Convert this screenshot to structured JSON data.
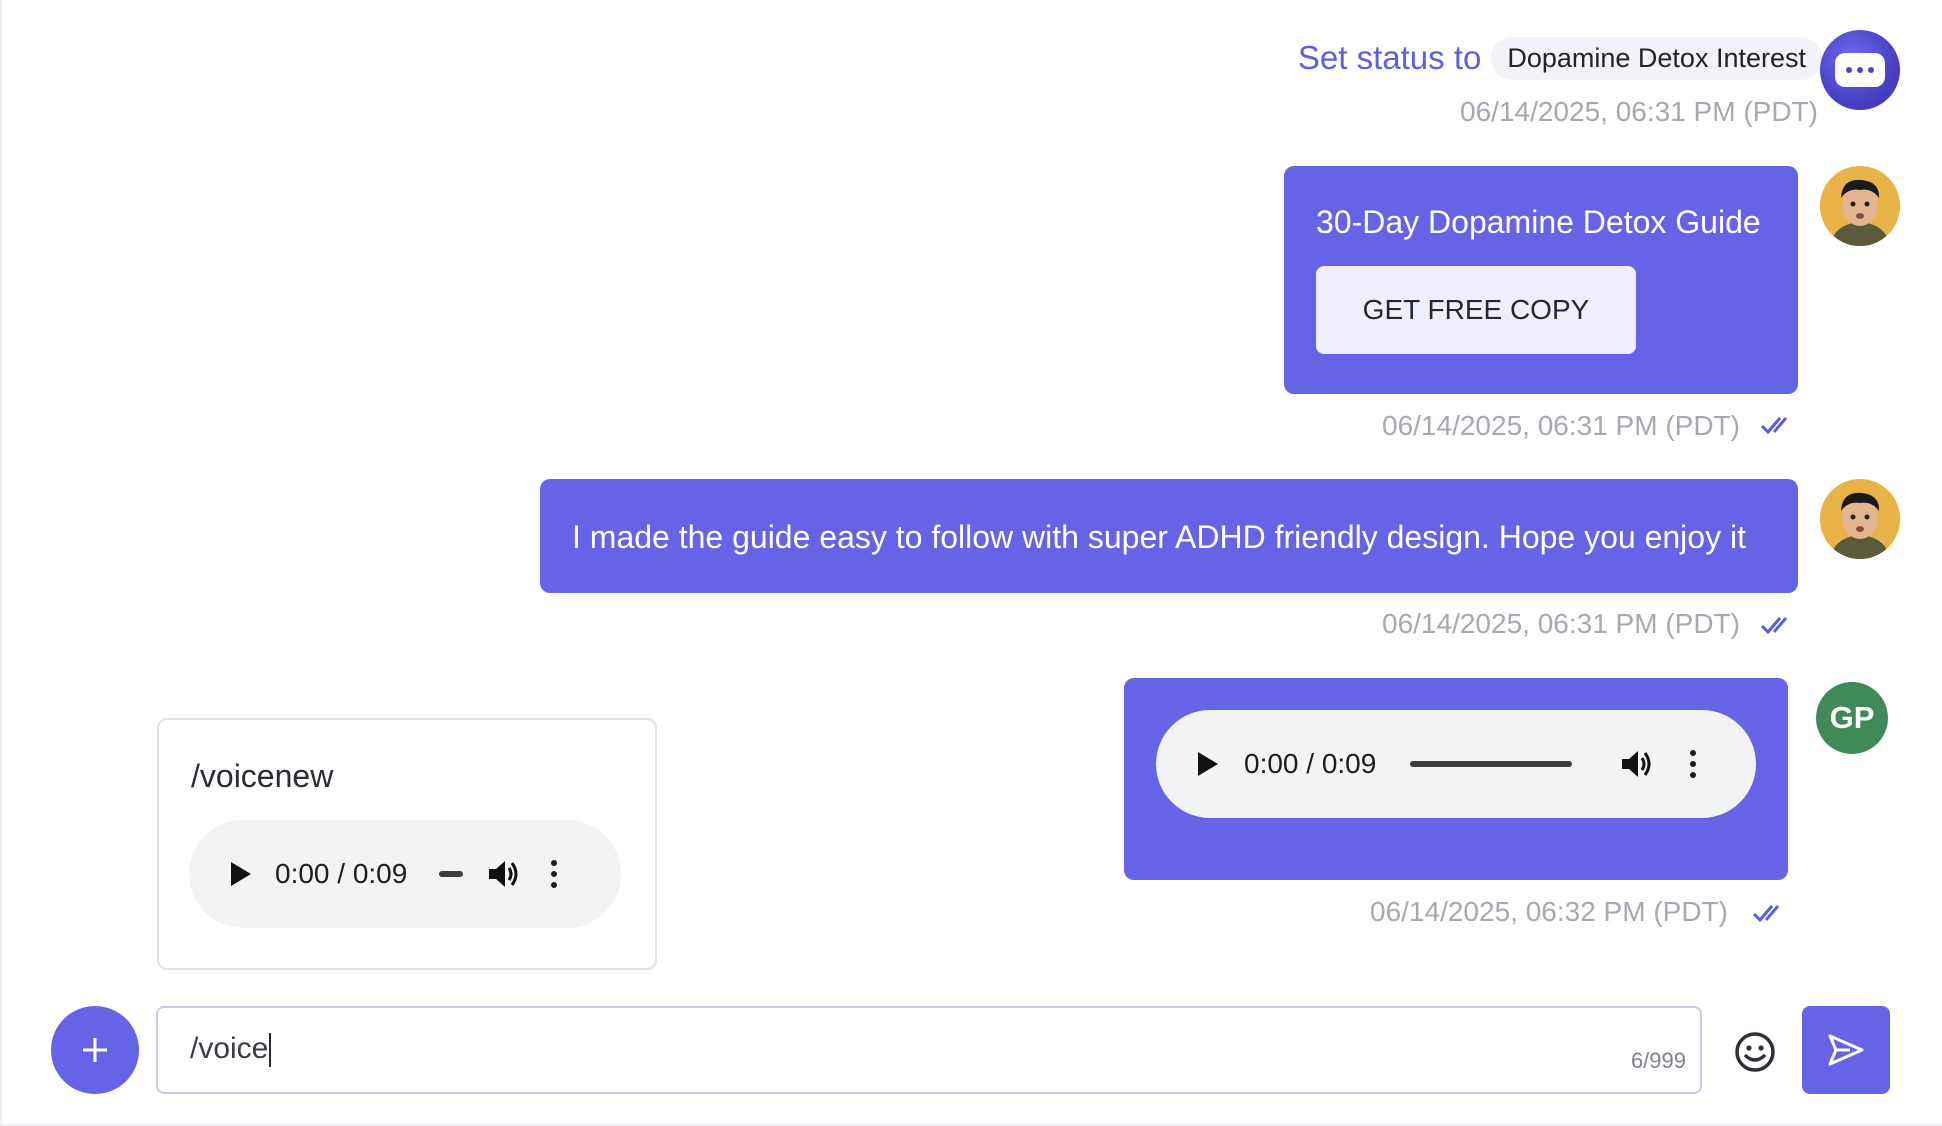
{
  "status": {
    "prefix": "Set status to",
    "value": "Dopamine Detox Interest",
    "timestamp": "06/14/2025, 06:31 PM (PDT)"
  },
  "messages": [
    {
      "title": "30-Day Dopamine Detox Guide",
      "button_label": "GET FREE COPY",
      "timestamp": "06/14/2025, 06:31 PM (PDT)"
    },
    {
      "text": "I made the guide easy to follow with super ADHD friendly design. Hope you enjoy it",
      "timestamp": "06/14/2025, 06:31 PM (PDT)"
    },
    {
      "audio_time": "0:00 / 0:09",
      "timestamp": "06/14/2025, 06:32 PM (PDT)",
      "sender_initials": "GP"
    }
  ],
  "suggestion": {
    "command": "/voicenew",
    "audio_time": "0:00 / 0:09"
  },
  "composer": {
    "value": "/voice",
    "counter": "6/999"
  },
  "colors": {
    "accent": "#6563e6",
    "bubble_text": "#ffffff",
    "timestamp": "#a6a8b3",
    "status_prefix": "#5b5fe0",
    "gp_avatar": "#3f8a56"
  },
  "icons": {
    "add": "plus-icon",
    "emoji": "smiley-icon",
    "send": "send-arrow-icon",
    "read": "double-check-icon",
    "play": "play-icon",
    "volume": "volume-icon",
    "more": "more-vertical-icon"
  }
}
